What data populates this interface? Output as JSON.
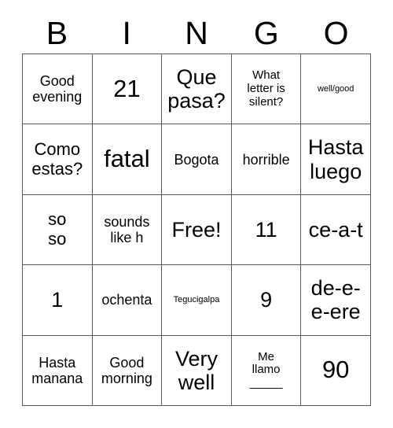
{
  "card": {
    "header": {
      "letters": [
        "B",
        "I",
        "N",
        "G",
        "O"
      ]
    },
    "rows": [
      [
        {
          "text": "Good\nevening",
          "size": "fs-md"
        },
        {
          "text": "21",
          "size": "fs-xxl"
        },
        {
          "text": "Que\npasa?",
          "size": "fs-xl"
        },
        {
          "text": "What\nletter is\nsilent?",
          "size": "fs-sm"
        },
        {
          "text": "well/good",
          "size": "fs-xs"
        }
      ],
      [
        {
          "text": "Como\nestas?",
          "size": "fs-lg"
        },
        {
          "text": "fatal",
          "size": "fs-xxl"
        },
        {
          "text": "Bogota",
          "size": "fs-md"
        },
        {
          "text": "horrible",
          "size": "fs-md"
        },
        {
          "text": "Hasta\nluego",
          "size": "fs-xl"
        }
      ],
      [
        {
          "text": "so\nso",
          "size": "fs-lg"
        },
        {
          "text": "sounds\nlike h",
          "size": "fs-md"
        },
        {
          "text": "Free!",
          "size": "fs-xl"
        },
        {
          "text": "11",
          "size": "fs-xl"
        },
        {
          "text": "ce-a-t",
          "size": "fs-xl"
        }
      ],
      [
        {
          "text": "1",
          "size": "fs-xl"
        },
        {
          "text": "ochenta",
          "size": "fs-md"
        },
        {
          "text": "Tegucigalpa",
          "size": "fs-xs"
        },
        {
          "text": "9",
          "size": "fs-xl"
        },
        {
          "text": "de-e-e-ere",
          "size": "fs-xl"
        }
      ],
      [
        {
          "text": "Hasta\nmanana",
          "size": "fs-md"
        },
        {
          "text": "Good\nmorning",
          "size": "fs-md"
        },
        {
          "text": "Very\nwell",
          "size": "fs-xl"
        },
        {
          "text": "Me\nllamo\n_____",
          "size": "fs-sm"
        },
        {
          "text": "90",
          "size": "fs-xxl"
        }
      ]
    ]
  }
}
